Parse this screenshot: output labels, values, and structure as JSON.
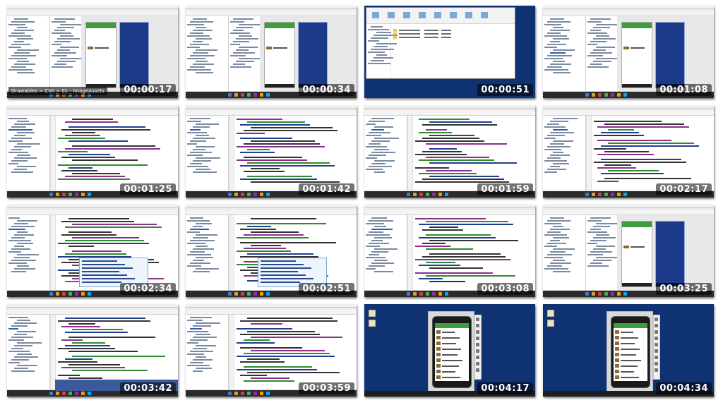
{
  "tiles": [
    {
      "timestamp": "00:00:17",
      "kind": "design",
      "caption": "Drawables > CVII > 01 - ImageAssets"
    },
    {
      "timestamp": "00:00:34",
      "kind": "design"
    },
    {
      "timestamp": "00:00:51",
      "kind": "explorer"
    },
    {
      "timestamp": "00:01:08",
      "kind": "design-selected"
    },
    {
      "timestamp": "00:01:25",
      "kind": "code"
    },
    {
      "timestamp": "00:01:42",
      "kind": "code"
    },
    {
      "timestamp": "00:01:59",
      "kind": "code"
    },
    {
      "timestamp": "00:02:17",
      "kind": "code"
    },
    {
      "timestamp": "00:02:34",
      "kind": "code-popup"
    },
    {
      "timestamp": "00:02:51",
      "kind": "code-popup"
    },
    {
      "timestamp": "00:03:08",
      "kind": "code"
    },
    {
      "timestamp": "00:03:25",
      "kind": "design"
    },
    {
      "timestamp": "00:03:42",
      "kind": "code-highlight"
    },
    {
      "timestamp": "00:03:59",
      "kind": "code"
    },
    {
      "timestamp": "00:04:17",
      "kind": "emulator"
    },
    {
      "timestamp": "00:04:34",
      "kind": "emulator"
    }
  ],
  "colors": {
    "desktop_blue": "#0f3273",
    "android_green": "#3f9c3f",
    "blueprint_blue": "#1b3a8a",
    "code_purple": "#8b2f8b",
    "code_green": "#2e8b2e",
    "code_navy": "#1f3f8f"
  }
}
